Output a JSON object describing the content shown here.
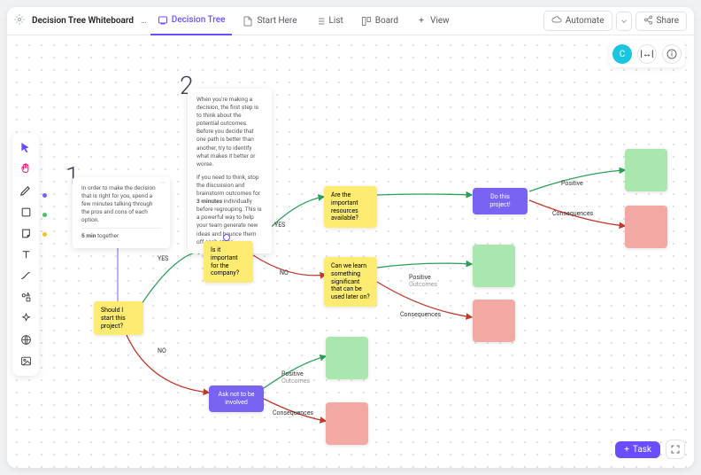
{
  "header": {
    "title": "Decision Tree Whiteboard",
    "title_suffix": "…",
    "tabs": [
      {
        "label": "Decision Tree",
        "active": true
      },
      {
        "label": "Start Here",
        "active": false
      },
      {
        "label": "List",
        "active": false
      },
      {
        "label": "Board",
        "active": false
      }
    ],
    "add_view_label": "View",
    "automate_label": "Automate",
    "share_label": "Share"
  },
  "avatar_initial": "C",
  "toolbar_icons": [
    "cursor",
    "hand",
    "pen",
    "square",
    "sticky",
    "text",
    "connector",
    "shapes",
    "sparkle",
    "globe",
    "image"
  ],
  "swatches": [
    "#7863f2",
    "#44c26b",
    "#f6c02d"
  ],
  "big_numbers": {
    "n1": "1",
    "n2": "2"
  },
  "notes": {
    "note1": {
      "body": "In order to make the decision that is right for you, spend a few minutes talking through the pros and cons of each option.",
      "foot_strong": "5 min",
      "foot_rest": " together"
    },
    "note2": {
      "p1": "When you're making a decision, the first step is to think about the potential outcomes. Before you decide that one path is better than another, try to identify what makes it better or worse.",
      "p2_a": "If you need to think, stop the discussion and brainstorm outcomes for ",
      "p2_strong": "3 minutes",
      "p2_b": " individually before regrouping. This is a powerful way to help your team generate new ideas and bounce them off each other."
    }
  },
  "nodes": {
    "start": "Should I start this project?",
    "important": "Is it important for the company?",
    "resources": "Are the important resources available?",
    "dothis": "Do this project!",
    "learn": "Can we learn something significant that can be used later on?",
    "asknot": "Ask not to be involved"
  },
  "edge_labels": {
    "yes": "YES",
    "no": "NO",
    "positive": "Positive",
    "outcomes": "Outcomes",
    "consequences": "Consequences"
  },
  "task_button": "Task"
}
